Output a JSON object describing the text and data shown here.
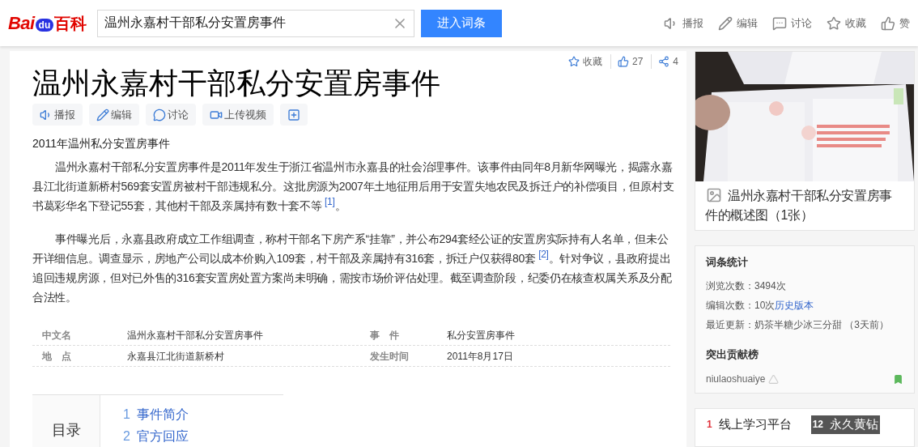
{
  "header": {
    "logo": {
      "part1": "Bai",
      "part2": "du",
      "part3": "百科"
    },
    "search": {
      "value": "温州永嘉村干部私分安置房事件"
    },
    "search_button": "进入词条",
    "actions": [
      {
        "kind": "speaker",
        "label": "播报"
      },
      {
        "kind": "edit",
        "label": "编辑"
      },
      {
        "kind": "discuss",
        "label": "讨论"
      },
      {
        "kind": "star",
        "label": "收藏"
      },
      {
        "kind": "like",
        "label": "赞"
      }
    ]
  },
  "article": {
    "stats": [
      {
        "kind": "star",
        "label": "收藏"
      },
      {
        "kind": "like",
        "label": "27"
      },
      {
        "kind": "share",
        "label": "4"
      }
    ],
    "title": "温州永嘉村干部私分安置房事件",
    "tools": [
      {
        "kind": "speaker",
        "label": "播报"
      },
      {
        "kind": "edit",
        "label": "编辑"
      },
      {
        "kind": "discuss",
        "label": "讨论"
      },
      {
        "kind": "video",
        "label": "上传视频"
      },
      {
        "kind": "plus"
      }
    ],
    "subtitle": "2011年温州私分安置房事件",
    "paragraphs": [
      {
        "text": "温州永嘉村干部私分安置房事件是2011年发生于浙江省温州市永嘉县的社会治理事件。该事件由同年8月新华网曝光，揭露永嘉县江北街道新桥村569套安置房被村干部违规私分。这批房源为2007年土地征用后用于安置失地农民及拆迁户的补偿项目，但原村支书葛彩华名下登记55套，其他村干部及亲属持有数十套不等",
        "ref": "[1]",
        "tail": "。"
      },
      {
        "text": "事件曝光后，永嘉县政府成立工作组调查，称村干部名下房产系“挂靠”，并公布294套经公证的安置房实际持有人名单，但未公开详细信息。调查显示，房地产公司以成本价购入109套，村干部及亲属持有316套，拆迁户仅获得80套",
        "ref": "[2]",
        "tail": "。针对争议，县政府提出追回违规房源，但对已外售的316套安置房处置方案尚未明确，需按市场价评估处理。截至调查阶段，纪委仍在核查权属关系及分配合法性。"
      }
    ],
    "infobox": [
      [
        {
          "name": "中文名",
          "value": "温州永嘉村干部私分安置房事件"
        },
        {
          "name": "事　件",
          "value": "私分安置房事件"
        }
      ],
      [
        {
          "name": "地　点",
          "value": "永嘉县江北街道新桥村"
        },
        {
          "name": "发生时间",
          "value": "2011年8月17日"
        }
      ]
    ],
    "toc": {
      "title": "目录",
      "items": [
        {
          "number": "1",
          "label": "事件简介"
        },
        {
          "number": "2",
          "label": "官方回应"
        }
      ]
    }
  },
  "sidebar": {
    "album": {
      "kind": "picture",
      "caption": "温州永嘉村干部私分安置房事件的概述图（1张）"
    },
    "stats": {
      "title": "词条统计",
      "views": "浏览次数：3494次",
      "edits": "编辑次数：10次",
      "history_link": "历史版本",
      "updated": "最近更新：奶茶半糖少冰三分甜 （3天前）"
    },
    "contributors": {
      "title": "突出贡献榜",
      "items": [
        {
          "name": "niulaoshuaiye"
        }
      ]
    },
    "hot_list": [
      {
        "number": "1",
        "label": "线上学习平台",
        "color": "#e0313a"
      },
      {
        "number": "12",
        "label": "永久黄钻",
        "color": "#ffffff"
      }
    ]
  }
}
